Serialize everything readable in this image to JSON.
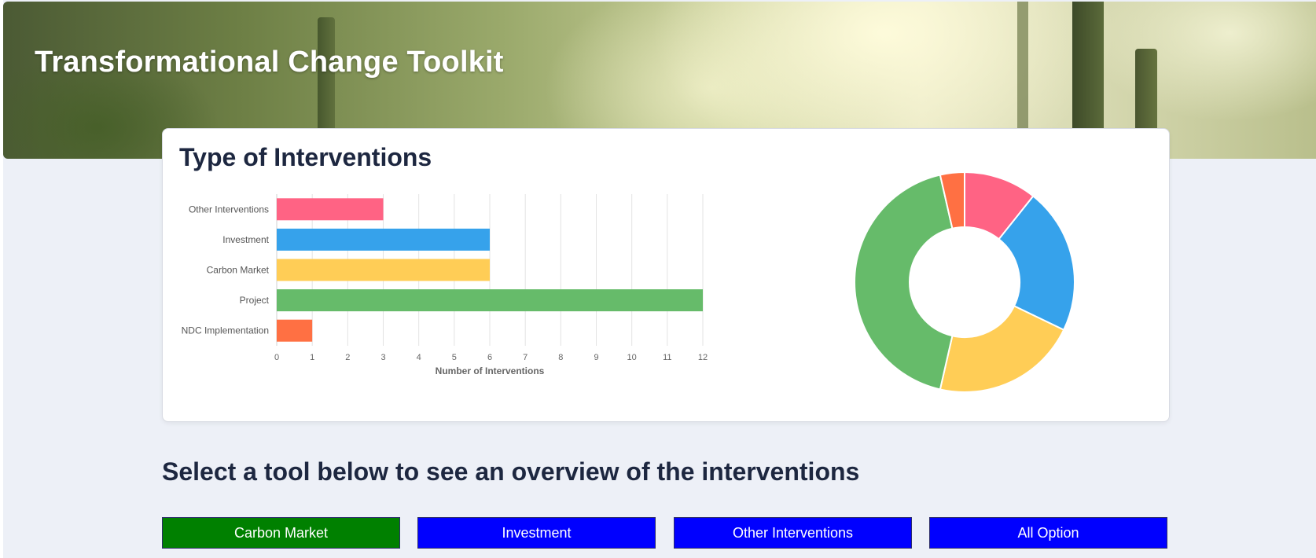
{
  "header": {
    "title": "Transformational Change Toolkit"
  },
  "card": {
    "title": "Type of Interventions"
  },
  "chart_data": [
    {
      "type": "bar",
      "orientation": "horizontal",
      "categories": [
        "Other Interventions",
        "Investment",
        "Carbon Market",
        "Project",
        "NDC Implementation"
      ],
      "values": [
        3,
        6,
        6,
        12,
        1
      ],
      "colors": [
        "#ff6384",
        "#36a2eb",
        "#ffcd56",
        "#66bb6a",
        "#ff7043"
      ],
      "xlabel": "Number of Interventions",
      "ylabel": "",
      "xlim": [
        0,
        12
      ],
      "xticks": [
        "0",
        "1",
        "2",
        "3",
        "4",
        "5",
        "6",
        "7",
        "8",
        "9",
        "10",
        "11",
        "12"
      ],
      "grid": true
    },
    {
      "type": "pie",
      "variant": "doughnut",
      "labels": [
        "Other Interventions",
        "Investment",
        "Carbon Market",
        "Project",
        "NDC Implementation"
      ],
      "values": [
        3,
        6,
        6,
        12,
        1
      ],
      "colors": [
        "#ff6384",
        "#36a2eb",
        "#ffcd56",
        "#66bb6a",
        "#ff7043"
      ]
    }
  ],
  "tools": {
    "heading": "Select a tool below to see an overview of the interventions",
    "buttons": [
      {
        "label": "Carbon Market",
        "color": "#008000",
        "active": true
      },
      {
        "label": "Investment",
        "color": "#0000ff",
        "active": false
      },
      {
        "label": "Other Interventions",
        "color": "#0000ff",
        "active": false
      },
      {
        "label": "All Option",
        "color": "#0000ff",
        "active": false
      }
    ]
  }
}
